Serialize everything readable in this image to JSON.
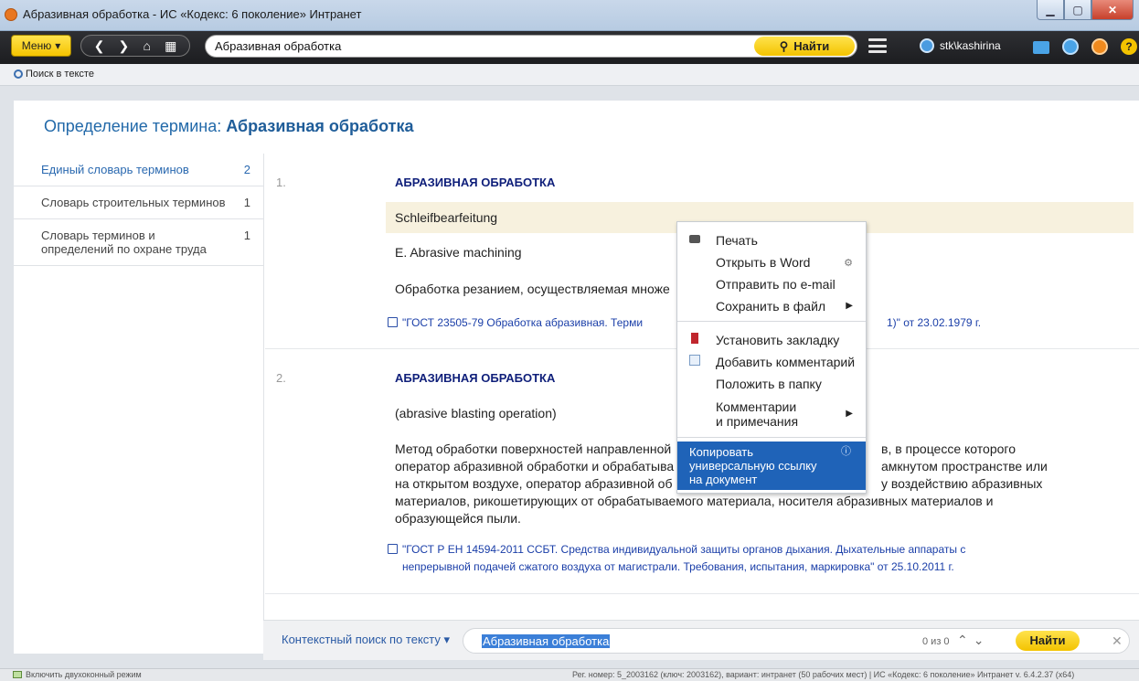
{
  "window": {
    "title": "Абразивная обработка - ИС «Кодекс: 6 поколение» Интранет"
  },
  "toolbar": {
    "menu_label": "Меню",
    "search_value": "Абразивная обработка",
    "find_label": "Найти",
    "username": "stk\\kashirina"
  },
  "subbar": {
    "search_in_text": "Поиск в тексте"
  },
  "page": {
    "title_prefix": "Определение термина:",
    "title_term": "Абразивная обработка"
  },
  "sidebar": {
    "items": [
      {
        "label": "Единый словарь терминов",
        "count": "2",
        "active": true
      },
      {
        "label": "Словарь строительных терминов",
        "count": "1",
        "active": false
      },
      {
        "label": "Словарь терминов и определений по охране труда",
        "count": "1",
        "active": false
      }
    ]
  },
  "entries": [
    {
      "number": "1.",
      "term": "АБРАЗИВНАЯ ОБРАБОТКА",
      "german": "Schleifbearfeitung",
      "english": "E. Abrasive machining",
      "definition": "Обработка резанием, осуществляемая множе",
      "source_prefix": "\"ГОСТ 23505-79 Обработка абразивная. Терми",
      "source_suffix": "1)\" от 23.02.1979 г."
    },
    {
      "number": "2.",
      "term": "АБРАЗИВНАЯ ОБРАБОТКА",
      "english": "(abrasive blasting operation)",
      "definition_lines": [
        "Метод обработки поверхностей направленной",
        "оператор абразивной обработки и обрабатыва",
        "на открытом воздухе, оператор абразивной об",
        "материалов, рикошетирующих от обрабатываемого материала, носителя абразивных материалов и",
        "образующейся пыли."
      ],
      "definition_right_lines": [
        "в, в процессе которого",
        "амкнутом пространстве или",
        "у воздействию абразивных"
      ],
      "source_lines": [
        "\"ГОСТ Р ЕН 14594-2011 ССБТ. Средства индивидуальной защиты органов дыхания. Дыхательные аппараты с",
        "непрерывной подачей сжатого воздуха от магистрали. Требования, испытания, маркировка\" от 25.10.2011 г."
      ]
    }
  ],
  "context_menu": {
    "items": {
      "print": "Печать",
      "open_word": "Открыть в Word",
      "send_email": "Отправить по e-mail",
      "save_file": "Сохранить в файл",
      "bookmark": "Установить закладку",
      "add_comment": "Добавить комментарий",
      "to_folder": "Положить в папку",
      "comments_notes_1": "Комментарии",
      "comments_notes_2": "и примечания",
      "copy_link_1": "Копировать",
      "copy_link_2": "универсальную ссылку",
      "copy_link_3": "на документ"
    }
  },
  "bottom_search": {
    "label": "Контекстный поиск по тексту",
    "value": "Абразивная обработка",
    "count": "0 из 0",
    "find_label": "Найти"
  },
  "statusbar": {
    "dual_mode": "Включить двухоконный режим",
    "registration": "Рег. номер: 5_2003162 (ключ: 2003162), вариант: интранет (50 рабочих мест)  |  ИС «Кодекс: 6 поколение» Интранет v. 6.4.2.37 (x64)"
  },
  "colors": {
    "accent_yellow": "#f5c400",
    "link_blue": "#2269a9",
    "term_navy": "#0f1f7a",
    "selection_blue": "#1f63b8"
  }
}
